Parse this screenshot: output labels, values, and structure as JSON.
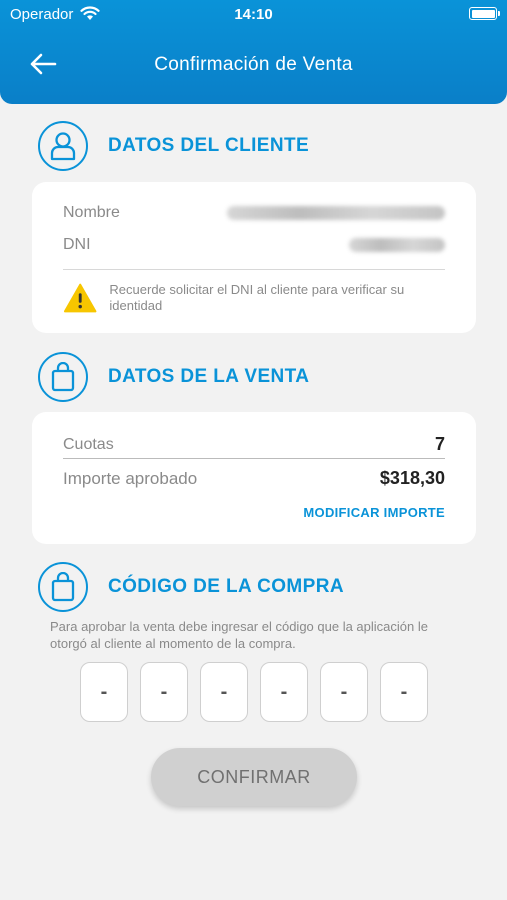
{
  "status_bar": {
    "carrier": "Operador",
    "time": "14:10"
  },
  "header": {
    "title": "Confirmación de Venta"
  },
  "client": {
    "section_title": "DATOS DEL CLIENTE",
    "name_label": "Nombre",
    "dni_label": "DNI",
    "warning": "Recuerde solicitar el DNI al cliente para verificar su identidad"
  },
  "sale": {
    "section_title": "DATOS DE LA VENTA",
    "cuotas_label": "Cuotas",
    "cuotas_value": "7",
    "importe_label": "Importe aprobado",
    "importe_value": "$318,30",
    "modify_link": "MODIFICAR IMPORTE"
  },
  "purchase_code": {
    "section_title": "CÓDIGO DE LA COMPRA",
    "instructions": "Para aprobar la venta debe ingresar el código que la aplicación le otorgó al cliente al momento de la compra.",
    "digits": [
      "-",
      "-",
      "-",
      "-",
      "-",
      "-"
    ]
  },
  "confirm_label": "CONFIRMAR",
  "colors": {
    "accent": "#0a93d8",
    "warning": "#f7c600",
    "button_disabled": "#d0d0d0"
  },
  "icons": [
    "wifi-icon",
    "battery-icon",
    "back-arrow-icon",
    "user-icon",
    "warning-icon",
    "shopping-bag-icon"
  ]
}
